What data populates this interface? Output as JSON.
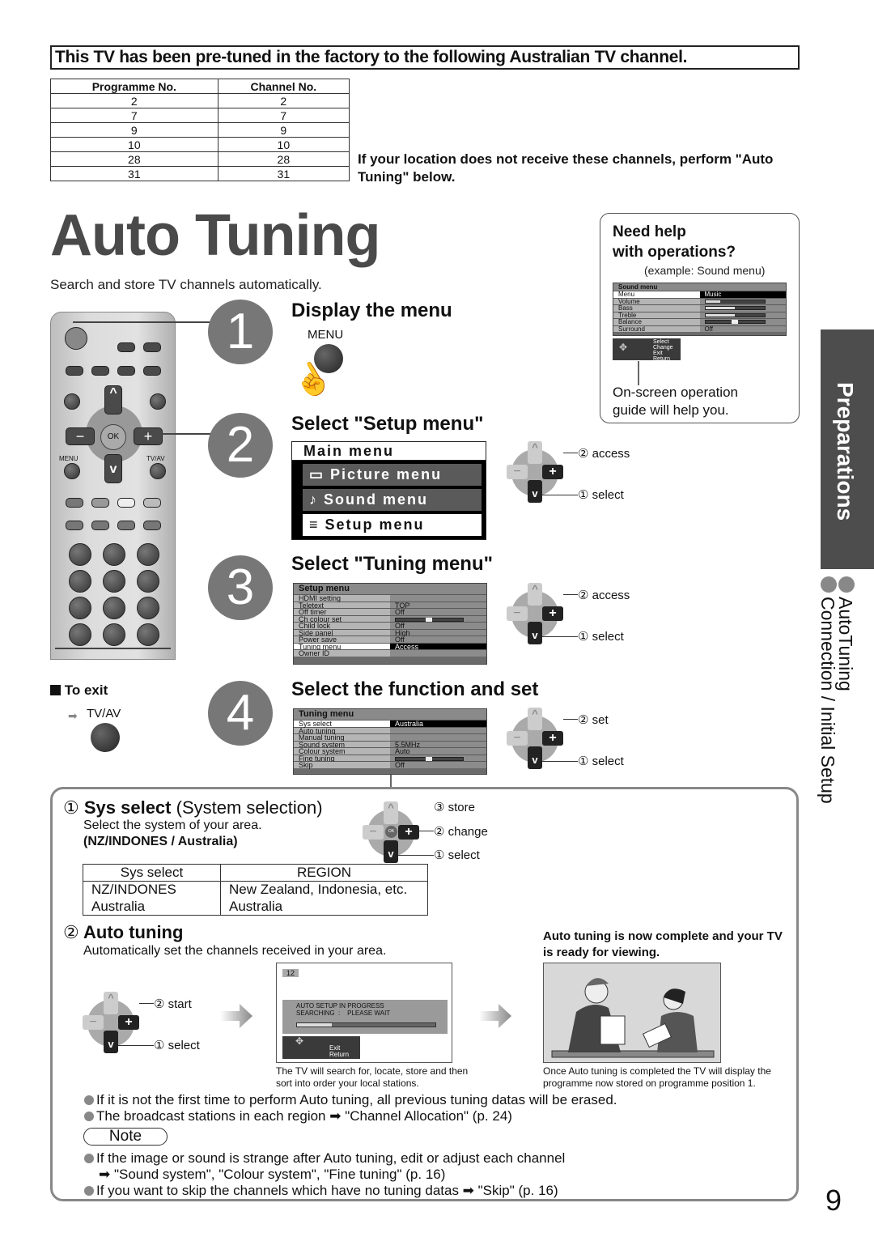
{
  "banner": "This TV has been pre-tuned in the factory to the following Australian TV channel.",
  "channel_table": {
    "headers": [
      "Programme No.",
      "Channel No."
    ],
    "rows": [
      [
        "2",
        "2"
      ],
      [
        "7",
        "7"
      ],
      [
        "9",
        "9"
      ],
      [
        "10",
        "10"
      ],
      [
        "28",
        "28"
      ],
      [
        "31",
        "31"
      ]
    ]
  },
  "location_note": "If your location does not receive these channels, perform \"Auto Tuning\" below.",
  "title": "Auto Tuning",
  "subtitle": "Search and store TV channels automatically.",
  "help": {
    "title_line1": "Need help",
    "title_line2": "with operations?",
    "example": "(example: Sound menu)",
    "menu_title": "Sound menu",
    "rows": [
      {
        "label": "Menu",
        "value": "Music",
        "selected": true
      },
      {
        "label": "Volume",
        "bar": 0.25
      },
      {
        "label": "Bass",
        "bar": 0.5
      },
      {
        "label": "Treble",
        "bar": 0.5
      },
      {
        "label": "Balance",
        "slider": 0.5
      },
      {
        "label": "Surround",
        "value": "Off"
      }
    ],
    "guide": [
      "Select",
      "Change",
      "Exit",
      "Return"
    ],
    "caption_line1": "On-screen operation",
    "caption_line2": "guide will help you."
  },
  "remote": {
    "menu_label": "MENU",
    "tvav_label": "TV/AV",
    "ok_label": "OK"
  },
  "steps": [
    {
      "num": "1",
      "title": "Display the menu",
      "button_label": "MENU"
    },
    {
      "num": "2",
      "title": "Select \"Setup menu\""
    },
    {
      "num": "3",
      "title": "Select \"Tuning menu\""
    },
    {
      "num": "4",
      "title": "Select the function and set"
    }
  ],
  "main_menu": {
    "title": "Main menu",
    "items": [
      {
        "icon": "▭",
        "label": "Picture menu"
      },
      {
        "icon": "♪",
        "label": "Sound menu"
      },
      {
        "icon": "≡",
        "label": "Setup menu",
        "selected": true
      }
    ]
  },
  "setup_menu": {
    "title": "Setup menu",
    "rows": [
      {
        "label": "HDMI setting",
        "value": ""
      },
      {
        "label": "Teletext",
        "value": "TOP"
      },
      {
        "label": "Off timer",
        "value": "Off"
      },
      {
        "label": "Ch colour set",
        "slider": 0.5
      },
      {
        "label": "Child lock",
        "value": "Off"
      },
      {
        "label": "Side panel",
        "value": "High"
      },
      {
        "label": "Power save",
        "value": "Off"
      },
      {
        "label": "Tuning menu",
        "value": "Access",
        "selected": true
      },
      {
        "label": "Owner ID",
        "value": ""
      }
    ]
  },
  "tuning_menu": {
    "title": "Tuning menu",
    "rows": [
      {
        "label": "Sys select",
        "value": "Australia",
        "selected": true
      },
      {
        "label": "Auto tuning",
        "value": ""
      },
      {
        "label": "Manual tuning",
        "value": ""
      },
      {
        "label": "Sound system",
        "value": "5.5MHz"
      },
      {
        "label": "Colour system",
        "value": "Auto"
      },
      {
        "label": "Fine tuning",
        "slider": 0.5
      },
      {
        "label": "Skip",
        "value": "Off"
      }
    ]
  },
  "dpad_labels": {
    "step2": {
      "plus": "② access",
      "down": "① select"
    },
    "step3": {
      "plus": "② access",
      "down": "① select"
    },
    "step4": {
      "plus": "② set",
      "down": "① select"
    },
    "sys": {
      "ok": "③ store",
      "plus": "② change",
      "down": "① select"
    },
    "auto": {
      "plus": "② start",
      "down": "① select"
    }
  },
  "to_exit": {
    "label": "To exit",
    "button": "TV/AV"
  },
  "sys_select": {
    "num": "①",
    "title_bold": "Sys select",
    "title_rest": "(System selection)",
    "desc": "Select the system of your area.",
    "options": "(NZ/INDONES / Australia)",
    "table": {
      "headers": [
        "Sys select",
        "REGION"
      ],
      "rows": [
        [
          "NZ/INDONES",
          "New Zealand, Indonesia, etc."
        ],
        [
          "Australia",
          "Australia"
        ]
      ]
    }
  },
  "auto_tuning": {
    "num": "②",
    "title": "Auto tuning",
    "desc": "Automatically set the channels received in your area.",
    "screen": {
      "channel": "12",
      "line1": "AUTO SETUP IN PROGRESS",
      "line2": "SEARCHING  :    PLEASE WAIT",
      "progress": 0.25,
      "guide": [
        "Exit",
        "Return"
      ]
    },
    "screen_caption": "The TV will search for, locate, store and then sort into order your local stations.",
    "complete_title": "Auto tuning is now complete and your TV is ready for viewing.",
    "complete_caption": "Once Auto tuning is completed the TV will display the programme now stored on programme position 1."
  },
  "bullets": [
    "If it is not the first time to perform Auto tuning, all previous tuning datas will be erased.",
    "The broadcast stations in each region ➡ \"Channel Allocation\" (p. 24)"
  ],
  "note": {
    "label": "Note",
    "items": [
      "If the image or sound is strange after Auto tuning, edit or adjust each channel",
      "➡ \"Sound system\", \"Colour system\", \"Fine tuning\" (p. 16)",
      "If you want to skip the channels which have no tuning datas ➡ \"Skip\" (p. 16)"
    ]
  },
  "side": {
    "tab": "Preparations",
    "line1": "AutoTuning",
    "line2": "Connection / Initial Setup"
  },
  "page_number": "9"
}
